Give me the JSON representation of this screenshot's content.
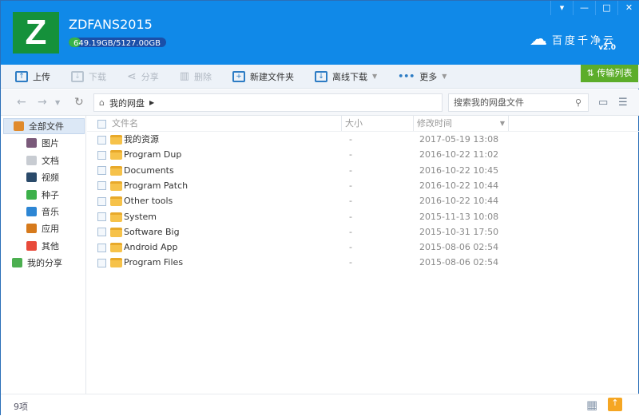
{
  "header": {
    "logo_letter": "Z",
    "username": "ZDFANS2015",
    "quota": "649.19GB/5127.00GB",
    "quota_used_fraction": 0.127,
    "brand": "百度千净云",
    "brand_version": "v2.0",
    "window_buttons": [
      "▾",
      "—",
      "□",
      "✕"
    ]
  },
  "toolbar": {
    "upload": "上传",
    "download": "下载",
    "share": "分享",
    "delete": "删除",
    "new_folder": "新建文件夹",
    "offline": "离线下载",
    "more": "更多",
    "transfer": "传输列表"
  },
  "nav": {
    "breadcrumb": "我的网盘",
    "search_placeholder": "搜索我的网盘文件"
  },
  "sidebar": {
    "items": [
      {
        "label": "全部文件",
        "color": "#e08a2c"
      },
      {
        "label": "图片",
        "color": "#7a5a7a"
      },
      {
        "label": "文档",
        "color": "#c8ccd2"
      },
      {
        "label": "视频",
        "color": "#2a4a6a"
      },
      {
        "label": "种子",
        "color": "#3cb04a"
      },
      {
        "label": "音乐",
        "color": "#2d86d4"
      },
      {
        "label": "应用",
        "color": "#d67a1c"
      },
      {
        "label": "其他",
        "color": "#e84a3a"
      },
      {
        "label": "我的分享",
        "color": "#4caf50"
      }
    ]
  },
  "columns": {
    "name": "文件名",
    "size": "大小",
    "modified": "修改时间"
  },
  "files": [
    {
      "name": "我的资源",
      "size": "-",
      "modified": "2017-05-19 13:08"
    },
    {
      "name": "Program Dup",
      "size": "-",
      "modified": "2016-10-22 11:02"
    },
    {
      "name": "Documents",
      "size": "-",
      "modified": "2016-10-22 10:45"
    },
    {
      "name": "Program Patch",
      "size": "-",
      "modified": "2016-10-22 10:44"
    },
    {
      "name": "Other tools",
      "size": "-",
      "modified": "2016-10-22 10:44"
    },
    {
      "name": "System",
      "size": "-",
      "modified": "2015-11-13 10:08"
    },
    {
      "name": "Software Big",
      "size": "-",
      "modified": "2015-10-31 17:50"
    },
    {
      "name": "Android App",
      "size": "-",
      "modified": "2015-08-06 02:54"
    },
    {
      "name": "Program Files",
      "size": "-",
      "modified": "2015-08-06 02:54"
    }
  ],
  "status": {
    "count": "9项"
  }
}
